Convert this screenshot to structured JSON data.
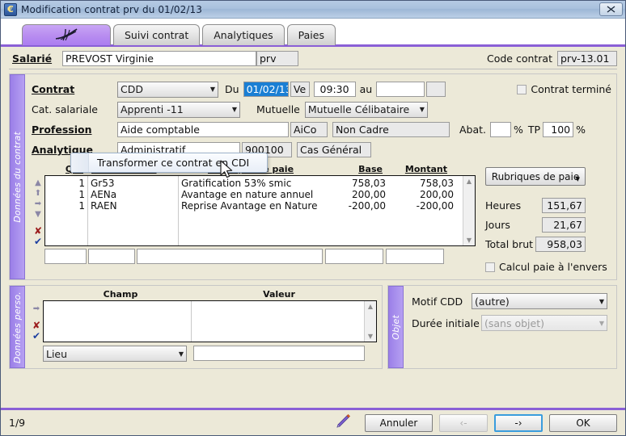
{
  "window": {
    "title": "Modification contrat prv du 01/02/13",
    "icon": "euro-app-icon",
    "close_label": "✕"
  },
  "tabs": [
    {
      "label": "",
      "glyph": "✳",
      "icon": "feather-icon",
      "active": true,
      "name": "tab-contrat"
    },
    {
      "label": "Suivi contrat",
      "glyph": "",
      "active": false,
      "name": "tab-suivi-contrat"
    },
    {
      "label": "Analytiques",
      "glyph": "",
      "active": false,
      "name": "tab-analytiques"
    },
    {
      "label": "Paies",
      "glyph": "",
      "active": false,
      "name": "tab-paies"
    }
  ],
  "header": {
    "salarie_label": "Salarié",
    "salarie_value": "PREVOST Virginie",
    "salarie_code": "prv",
    "code_contrat_label": "Code contrat",
    "code_contrat_value": "prv-13.01"
  },
  "sidebands": {
    "donnees_contrat": "Données du contrat",
    "donnees_perso": "Données perso.",
    "objet": "Objet"
  },
  "contract": {
    "contrat_label": "Contrat",
    "contrat_value": "CDD",
    "du_label": "Du",
    "du_value": "01/02/13",
    "du_day": "Ve",
    "heure_value": "09:30",
    "au_label": "au",
    "au_value": "",
    "au_day": "",
    "contrat_termine_label": "Contrat terminé",
    "contrat_termine_checked": false,
    "cat_salariale_label": "Cat. salariale",
    "cat_salariale_value": "Apprenti -11",
    "mutuelle_label": "Mutuelle",
    "mutuelle_value": "Mutuelle Célibataire",
    "profession_label": "Profession",
    "profession_value": "Aide comptable",
    "profession_code": "AiCo",
    "profession_cadre": "Non Cadre",
    "abat_label": "Abat.",
    "abat_value": "",
    "abat_unit": "%",
    "tp_label": "TP",
    "tp_value": "100",
    "tp_unit": "%",
    "analytique_label": "Analytique",
    "analytique_value": "Administratif",
    "analytique_code": "900100",
    "analytique_cas": "Cas Général"
  },
  "context_menu": {
    "items": [
      "Transformer ce contrat en CDI"
    ]
  },
  "rubriques": {
    "columns": [
      "Qté",
      "Code / Macro",
      "Rubrique de paie",
      "Base",
      "Montant"
    ],
    "rows": [
      {
        "qte": "1",
        "code": "Gr53",
        "libelle": "Gratification 53% smic",
        "base": "758,03",
        "montant": "758,03"
      },
      {
        "qte": "1",
        "code": "AENa",
        "libelle": "Avantage en nature annuel",
        "base": "200,00",
        "montant": "200,00"
      },
      {
        "qte": "1",
        "code": "RAEN",
        "libelle": "Reprise Avantage en Nature",
        "base": "-200,00",
        "montant": "-200,00"
      }
    ],
    "new_row": {
      "qte": "",
      "code": "",
      "libelle": "",
      "base": "",
      "montant": ""
    },
    "side_icons": [
      "move-up-icon",
      "move-top-icon",
      "move-right-icon",
      "move-down-icon",
      "delete-row-icon",
      "validate-row-icon"
    ]
  },
  "totals": {
    "rubriques_button": "Rubriques de paie",
    "heures_label": "Heures",
    "heures_value": "151,67",
    "jours_label": "Jours",
    "jours_value": "21,67",
    "total_brut_label": "Total brut",
    "total_brut_value": "958,03",
    "calcul_envers_label": "Calcul paie à l'envers",
    "calcul_envers_checked": false
  },
  "donnees_perso": {
    "columns": [
      "Champ",
      "Valeur"
    ],
    "rows": [],
    "champ_selected": "Lieu",
    "valeur_value": "",
    "side_icons": [
      "move-right-icon",
      "delete-row-icon",
      "validate-row-icon"
    ]
  },
  "objet": {
    "motif_label": "Motif CDD",
    "motif_value": "(autre)",
    "duree_label": "Durée initiale",
    "duree_value": "(sans objet)",
    "duree_disabled": true
  },
  "footer": {
    "page": "1/9",
    "pencil_icon": "pencil-icon",
    "cancel_label": "Annuler",
    "prev_label": "‹-",
    "next_label": "-›",
    "ok_label": "OK"
  },
  "colors": {
    "accent_purple": "#8a5fd6",
    "tab_active": "#b98ef0",
    "selection_blue": "#1a7fd4",
    "titlebar_blue": "#a9c1dd"
  }
}
